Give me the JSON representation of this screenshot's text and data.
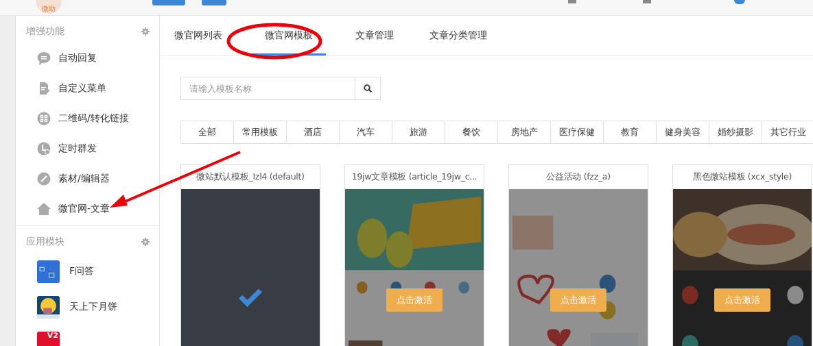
{
  "header": {
    "logo_text": "微助"
  },
  "sidebar": {
    "sections": [
      {
        "title": "增强功能",
        "items": [
          {
            "label": "自动回复"
          },
          {
            "label": "自定义菜单"
          },
          {
            "label": "二维码/转化链接"
          },
          {
            "label": "定时群发"
          },
          {
            "label": "素材/编辑器"
          },
          {
            "label": "微官网-文章"
          }
        ]
      },
      {
        "title": "应用模块",
        "items": [
          {
            "label": "F问答"
          },
          {
            "label": "天上下月饼"
          },
          {
            "badge": "V2"
          }
        ]
      }
    ]
  },
  "tabs": [
    {
      "label": "微官网列表",
      "selected": false
    },
    {
      "label": "微官网模板",
      "selected": true
    },
    {
      "label": "文章管理",
      "selected": false
    },
    {
      "label": "文章分类管理",
      "selected": false
    }
  ],
  "search": {
    "placeholder": "请输入模板名称"
  },
  "categories": [
    "全部",
    "常用模板",
    "酒店",
    "汽车",
    "旅游",
    "餐饮",
    "房地产",
    "医疗保健",
    "教育",
    "健身美容",
    "婚纱摄影",
    "其它行业"
  ],
  "templates": [
    {
      "title": "微站默认模板_Izl4 (default)",
      "active": true
    },
    {
      "title": "19jw文章模板 (article_19jw_c...",
      "active": false,
      "button": "点击激活"
    },
    {
      "title": "公益活动 (fzz_a)",
      "active": false,
      "button": "点击激活"
    },
    {
      "title": "黑色微站模板 (xcx_style)",
      "active": false,
      "button": "点击激活"
    }
  ]
}
